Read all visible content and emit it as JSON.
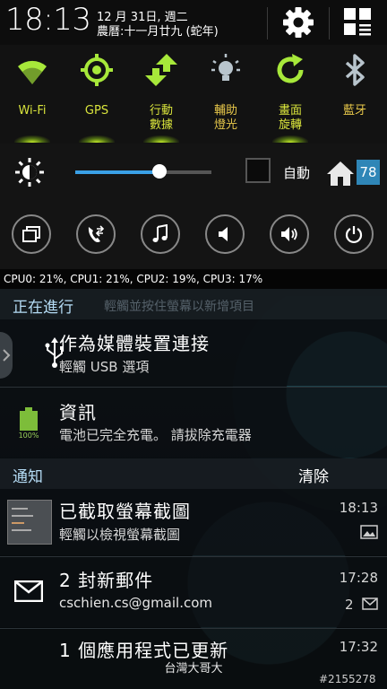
{
  "status": {
    "time": "18:13",
    "date_line1": "12 月 31日, 週二",
    "date_line2": "農曆:十一月廿九 (蛇年)"
  },
  "toggles": [
    {
      "label": "Wi-Fi",
      "icon": "wifi-icon",
      "state": "on"
    },
    {
      "label": "GPS",
      "icon": "gps-icon",
      "state": "on"
    },
    {
      "label": "行動\n數據",
      "icon": "mobile-data-icon",
      "state": "on"
    },
    {
      "label": "輔助\n燈光",
      "icon": "flashlight-icon",
      "state": "off"
    },
    {
      "label": "畫面\n旋轉",
      "icon": "rotate-icon",
      "state": "on"
    },
    {
      "label": "藍牙",
      "icon": "bluetooth-icon",
      "state": "off"
    }
  ],
  "brightness": {
    "auto_label": "自動",
    "level": 0.62,
    "temperature": "78"
  },
  "cpu_text": "CPU0: 21%, CPU1: 21%, CPU2: 19%, CPU3: 17%",
  "ongoing": {
    "title": "正在進行",
    "hint": "輕觸並按住螢幕以新增項目",
    "items": [
      {
        "title": "作為媒體裝置連接",
        "sub": "輕觸 USB 選項",
        "icon": "usb-icon"
      },
      {
        "title": "資訊",
        "sub": "電池已完全充電。 請拔除充電器",
        "icon": "battery-full-icon",
        "badge": "100%"
      }
    ]
  },
  "notifications": {
    "title": "通知",
    "clear_label": "清除",
    "items": [
      {
        "title": "已截取螢幕截圖",
        "sub": "輕觸以檢視螢幕截圖",
        "time": "18:13",
        "icon": "screenshot-thumbnail"
      },
      {
        "title": "2 封新郵件",
        "sub": "cschien.cs@gmail.com",
        "time": "17:28",
        "count": "2",
        "icon": "gmail-icon"
      },
      {
        "title": "1 個應用程式已更新",
        "time": "17:32",
        "icon": "app-update-icon"
      }
    ]
  },
  "carrier": "台灣大哥大",
  "watermark": "#2155278",
  "colors": {
    "accent_on": "#c6f02a",
    "label_on": "#d9e43c",
    "label_off": "#e8c84a",
    "section_header": "#b5dcf5"
  }
}
